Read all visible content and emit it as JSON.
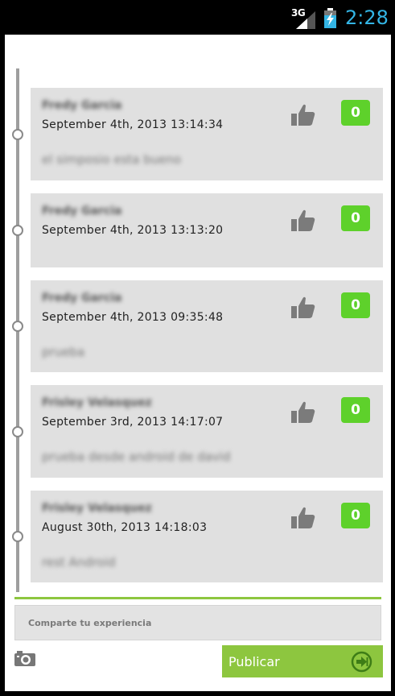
{
  "status_bar": {
    "network": "3G",
    "time": "2:28"
  },
  "feed": {
    "posts": [
      {
        "author": "Fredy Garcia",
        "date": "September 4th, 2013 13:14:34",
        "message": "el simposio esta bueno",
        "likes": "0"
      },
      {
        "author": "Fredy Garcia",
        "date": "September 4th, 2013 13:13:20",
        "message": "",
        "likes": "0"
      },
      {
        "author": "Fredy Garcia",
        "date": "September 4th, 2013 09:35:48",
        "message": "prueba",
        "likes": "0"
      },
      {
        "author": "Frisley Velasquez",
        "date": "September 3rd, 2013 14:17:07",
        "message": "prueba desde android de david",
        "likes": "0"
      },
      {
        "author": "Frisley Velasquez",
        "date": "August 30th, 2013 14:18:03",
        "message": "rest Android",
        "likes": "0"
      }
    ]
  },
  "composer": {
    "placeholder": "Comparte tu experiencia",
    "publish_label": "Publicar"
  },
  "colors": {
    "accent_green": "#8dc63f",
    "like_badge": "#5ed12b",
    "clock_blue": "#33b5e5"
  },
  "icons": [
    "signal-icon",
    "battery-charging-icon",
    "thumbs-up-icon",
    "camera-icon",
    "send-arrow-icon"
  ]
}
